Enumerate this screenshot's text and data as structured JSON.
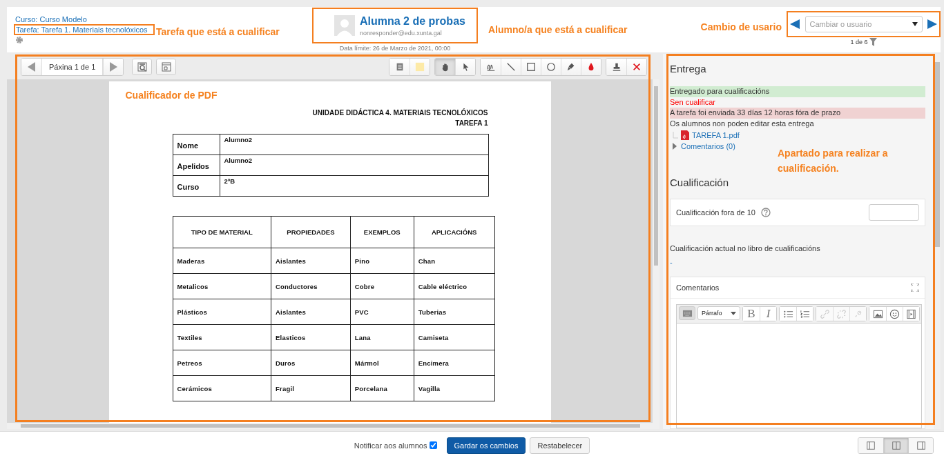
{
  "header": {
    "course_link": "Curso: Curso Modelo",
    "assignment_link": "Tarefa: Tarefa 1. Materiais tecnolóxicos",
    "user": {
      "name": "Alumna 2 de probas",
      "email": "nonresponder@edu.xunta.gal"
    },
    "due_date": "Data límite: 26 de Marzo de 2021, 00:00",
    "user_select": {
      "placeholder": "Cambiar o usuario"
    },
    "user_count": "1 de 6"
  },
  "annotations": {
    "assignment": "Tarefa que está a cualificar",
    "user": "Alumno/a que está a cualificar",
    "switcher": "Cambio de usario",
    "pdf": "Cualificador de PDF",
    "grading": "Apartado para realizar a cualificación."
  },
  "pdf_toolbar": {
    "page_label": "Páxina 1 de 1",
    "tool_groups": [
      [
        {
          "kind": "comment-list",
          "selected": false
        },
        {
          "kind": "swatch",
          "selected": false
        }
      ],
      [
        {
          "kind": "hand",
          "selected": true
        },
        {
          "kind": "pointer",
          "selected": false
        }
      ],
      [
        {
          "kind": "pen",
          "selected": false
        },
        {
          "kind": "line",
          "selected": false
        },
        {
          "kind": "rectangle",
          "selected": false
        },
        {
          "kind": "oval",
          "selected": false
        },
        {
          "kind": "highlighter",
          "selected": false
        },
        {
          "kind": "color",
          "selected": false
        }
      ],
      [
        {
          "kind": "stamp",
          "selected": false
        },
        {
          "kind": "delete",
          "selected": false
        }
      ]
    ]
  },
  "document": {
    "heading": "UNIDADE DIDÁCTICA 4. MATERIAIS TECNOLÓXICOS",
    "subheading": "TAREFA 1",
    "student_table": [
      [
        "Nome",
        "Alumno2"
      ],
      [
        "Apelidos",
        "Alumno2"
      ],
      [
        "Curso",
        "2ºB"
      ]
    ],
    "materials_table": {
      "columns": [
        "TIPO DE MATERIAL",
        "PROPIEDADES",
        "EXEMPLOS",
        "APLICACIÓNS"
      ],
      "rows": [
        [
          "Maderas",
          "Aislantes",
          "Pino",
          "Chan"
        ],
        [
          "Metalicos",
          "Conductores",
          "Cobre",
          "Cable eléctrico"
        ],
        [
          "Plásticos",
          "Aislantes",
          "PVC",
          "Tuberias"
        ],
        [
          "Textiles",
          "Elasticos",
          "Lana",
          "Camiseta"
        ],
        [
          "Petreos",
          "Duros",
          "Mármol",
          "Encimera"
        ],
        [
          "Cerámicos",
          "Fragil",
          "Porcelana",
          "Vagilla"
        ]
      ]
    }
  },
  "submission": {
    "title": "Entrega",
    "statuses": [
      {
        "kind": "success",
        "text": "Entregado para cualificacións"
      },
      {
        "kind": "alert",
        "text": "Sen cualificar"
      },
      {
        "kind": "danger",
        "text": "A tarefa foi enviada 33 días 12 horas fóra de prazo"
      },
      {
        "kind": "plain",
        "text": "Os alumnos non poden editar esta entrega"
      }
    ],
    "file": "TAREFA 1.pdf",
    "comments_link": "Comentarios (0)"
  },
  "grade": {
    "title": "Cualificación",
    "label": "Cualificación fora de 10",
    "current_label": "Cualificación actual no libro de cualificacións",
    "current_value": "-",
    "comments_title": "Comentarios",
    "editor": {
      "format": "Párrafo",
      "button_groups": [
        [
          {
            "kind": "keyboard",
            "disabled": false
          }
        ],
        [
          {
            "kind": "bold",
            "label": "B",
            "disabled": false
          },
          {
            "kind": "italic",
            "label": "I",
            "disabled": false
          }
        ],
        [
          {
            "kind": "bullets",
            "disabled": false
          },
          {
            "kind": "numbers",
            "disabled": false
          }
        ],
        [
          {
            "kind": "link",
            "disabled": true
          },
          {
            "kind": "unlink",
            "disabled": true
          },
          {
            "kind": "anchor",
            "disabled": true
          }
        ],
        [
          {
            "kind": "image",
            "disabled": false
          },
          {
            "kind": "emoji",
            "disabled": false
          },
          {
            "kind": "media",
            "disabled": false
          }
        ]
      ]
    }
  },
  "footer": {
    "notify": {
      "label": "Notificar aos alumnos",
      "checked": true
    },
    "save": "Gardar os cambios",
    "reset": "Restabelecer",
    "layouts": [
      {
        "kind": "pdf-wide",
        "selected": false
      },
      {
        "kind": "split",
        "selected": true
      },
      {
        "kind": "grade-wide",
        "selected": false
      }
    ]
  }
}
